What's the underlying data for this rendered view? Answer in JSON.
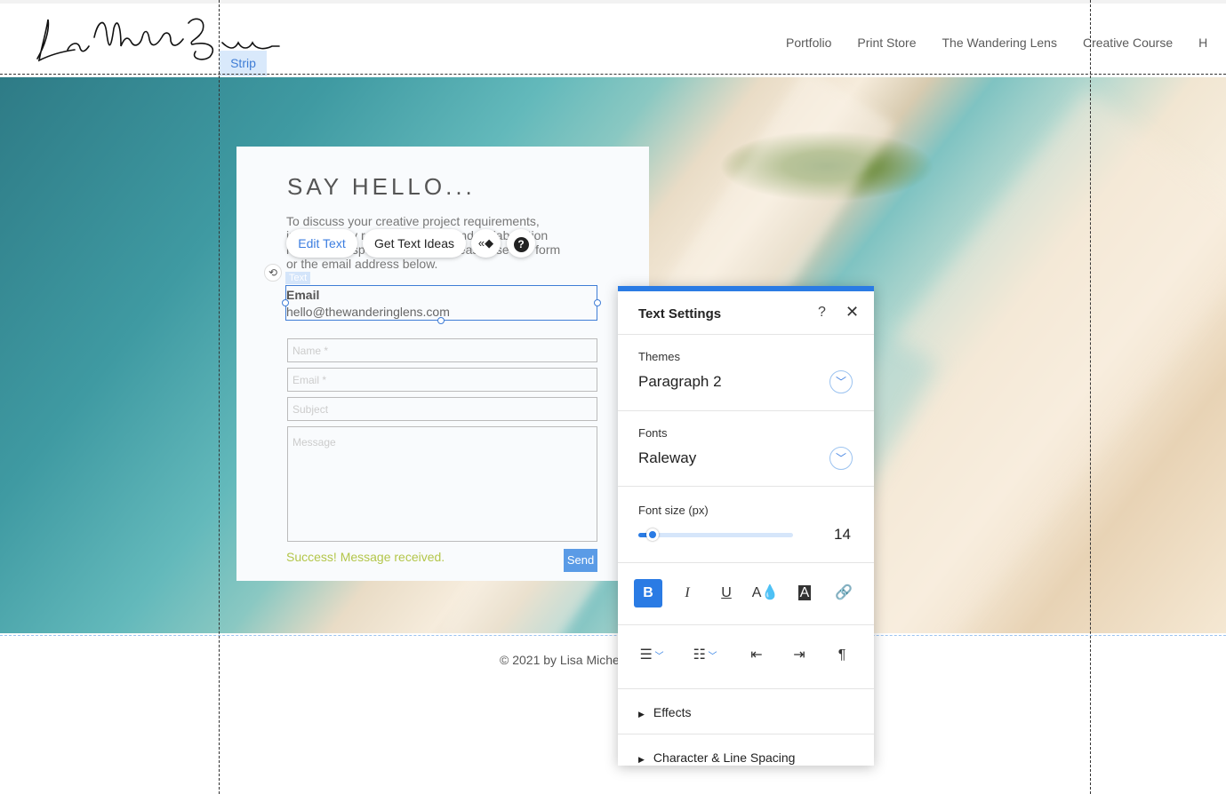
{
  "header": {
    "logo_text": "Lisa Michele Burns",
    "nav": [
      "Portfolio",
      "Print Store",
      "The Wandering Lens",
      "Creative Course",
      "H"
    ],
    "strip_label": "Strip"
  },
  "contact": {
    "title": "SAY HELLO...",
    "description": "To discuss your creative project requirements, image library requests, media and collaboration requests or speaking events, please use this form or the email address below.",
    "text_tag": "Text",
    "email_label": "Email",
    "email_value": "hello@thewanderinglens.com",
    "name_placeholder": "Name *",
    "email_placeholder": "Email *",
    "subject_placeholder": "Subject",
    "message_placeholder": "Message",
    "success_message": "Success! Message received.",
    "send_label": "Send"
  },
  "toolbar": {
    "edit_text": "Edit Text",
    "get_ideas": "Get Text Ideas",
    "animation_glyph": "«◆",
    "help_glyph": "?"
  },
  "footer": {
    "copyright": "© 2021 by Lisa Miche"
  },
  "panel": {
    "title": "Text Settings",
    "help_glyph": "?",
    "close_glyph": "✕",
    "themes_label": "Themes",
    "themes_value": "Paragraph 2",
    "fonts_label": "Fonts",
    "fonts_value": "Raleway",
    "font_size_label": "Font size (px)",
    "font_size_value": "14",
    "font_size_fraction": 0.09,
    "format_buttons": {
      "bold": "B",
      "italic": "I",
      "underline": "U"
    },
    "effects_label": "Effects",
    "spacing_label": "Character & Line Spacing",
    "accent_color": "#2a7be4"
  }
}
